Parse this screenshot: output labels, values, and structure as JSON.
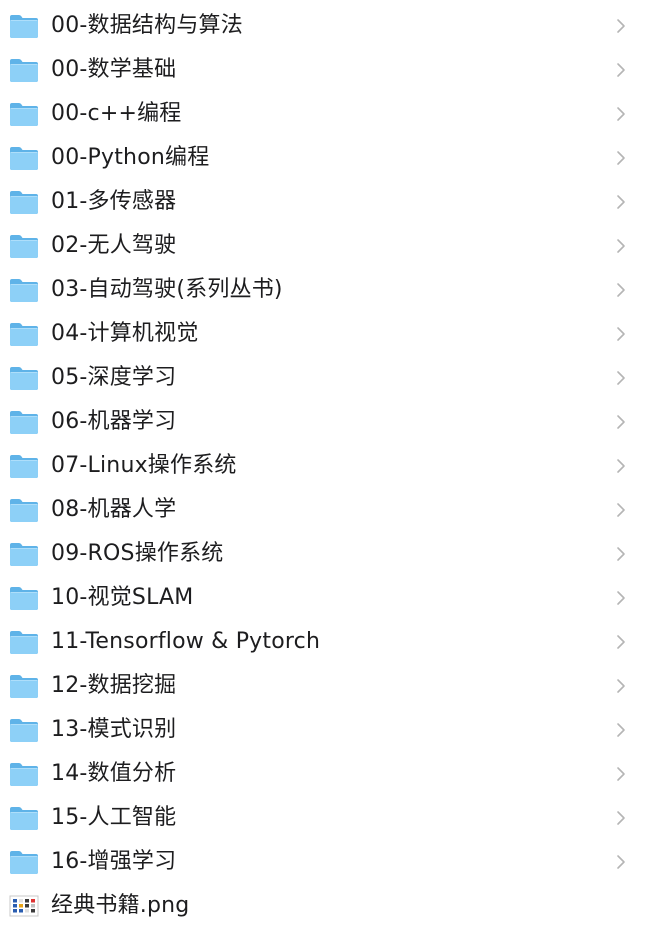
{
  "items": [
    {
      "name": "00-数据结构与算法",
      "kind": "folder"
    },
    {
      "name": "00-数学基础",
      "kind": "folder"
    },
    {
      "name": "00-c++编程",
      "kind": "folder"
    },
    {
      "name": "00-Python编程",
      "kind": "folder"
    },
    {
      "name": "01-多传感器",
      "kind": "folder"
    },
    {
      "name": "02-无人驾驶",
      "kind": "folder"
    },
    {
      "name": "03-自动驾驶(系列丛书)",
      "kind": "folder"
    },
    {
      "name": "04-计算机视觉",
      "kind": "folder"
    },
    {
      "name": "05-深度学习",
      "kind": "folder"
    },
    {
      "name": "06-机器学习",
      "kind": "folder"
    },
    {
      "name": "07-Linux操作系统",
      "kind": "folder"
    },
    {
      "name": "08-机器人学",
      "kind": "folder"
    },
    {
      "name": "09-ROS操作系统",
      "kind": "folder"
    },
    {
      "name": "10-视觉SLAM",
      "kind": "folder"
    },
    {
      "name": "11-Tensorflow & Pytorch",
      "kind": "folder"
    },
    {
      "name": "12-数据挖掘",
      "kind": "folder"
    },
    {
      "name": "13-模式识别",
      "kind": "folder"
    },
    {
      "name": "14-数值分析",
      "kind": "folder"
    },
    {
      "name": "15-人工智能",
      "kind": "folder"
    },
    {
      "name": "16-增强学习",
      "kind": "folder"
    },
    {
      "name": "经典书籍.png",
      "kind": "file"
    }
  ],
  "colors": {
    "folder_back": "#5fb3e8",
    "folder_front": "#8dd0f7",
    "chevron": "#b5b5b5",
    "text": "#1d1d1f"
  }
}
